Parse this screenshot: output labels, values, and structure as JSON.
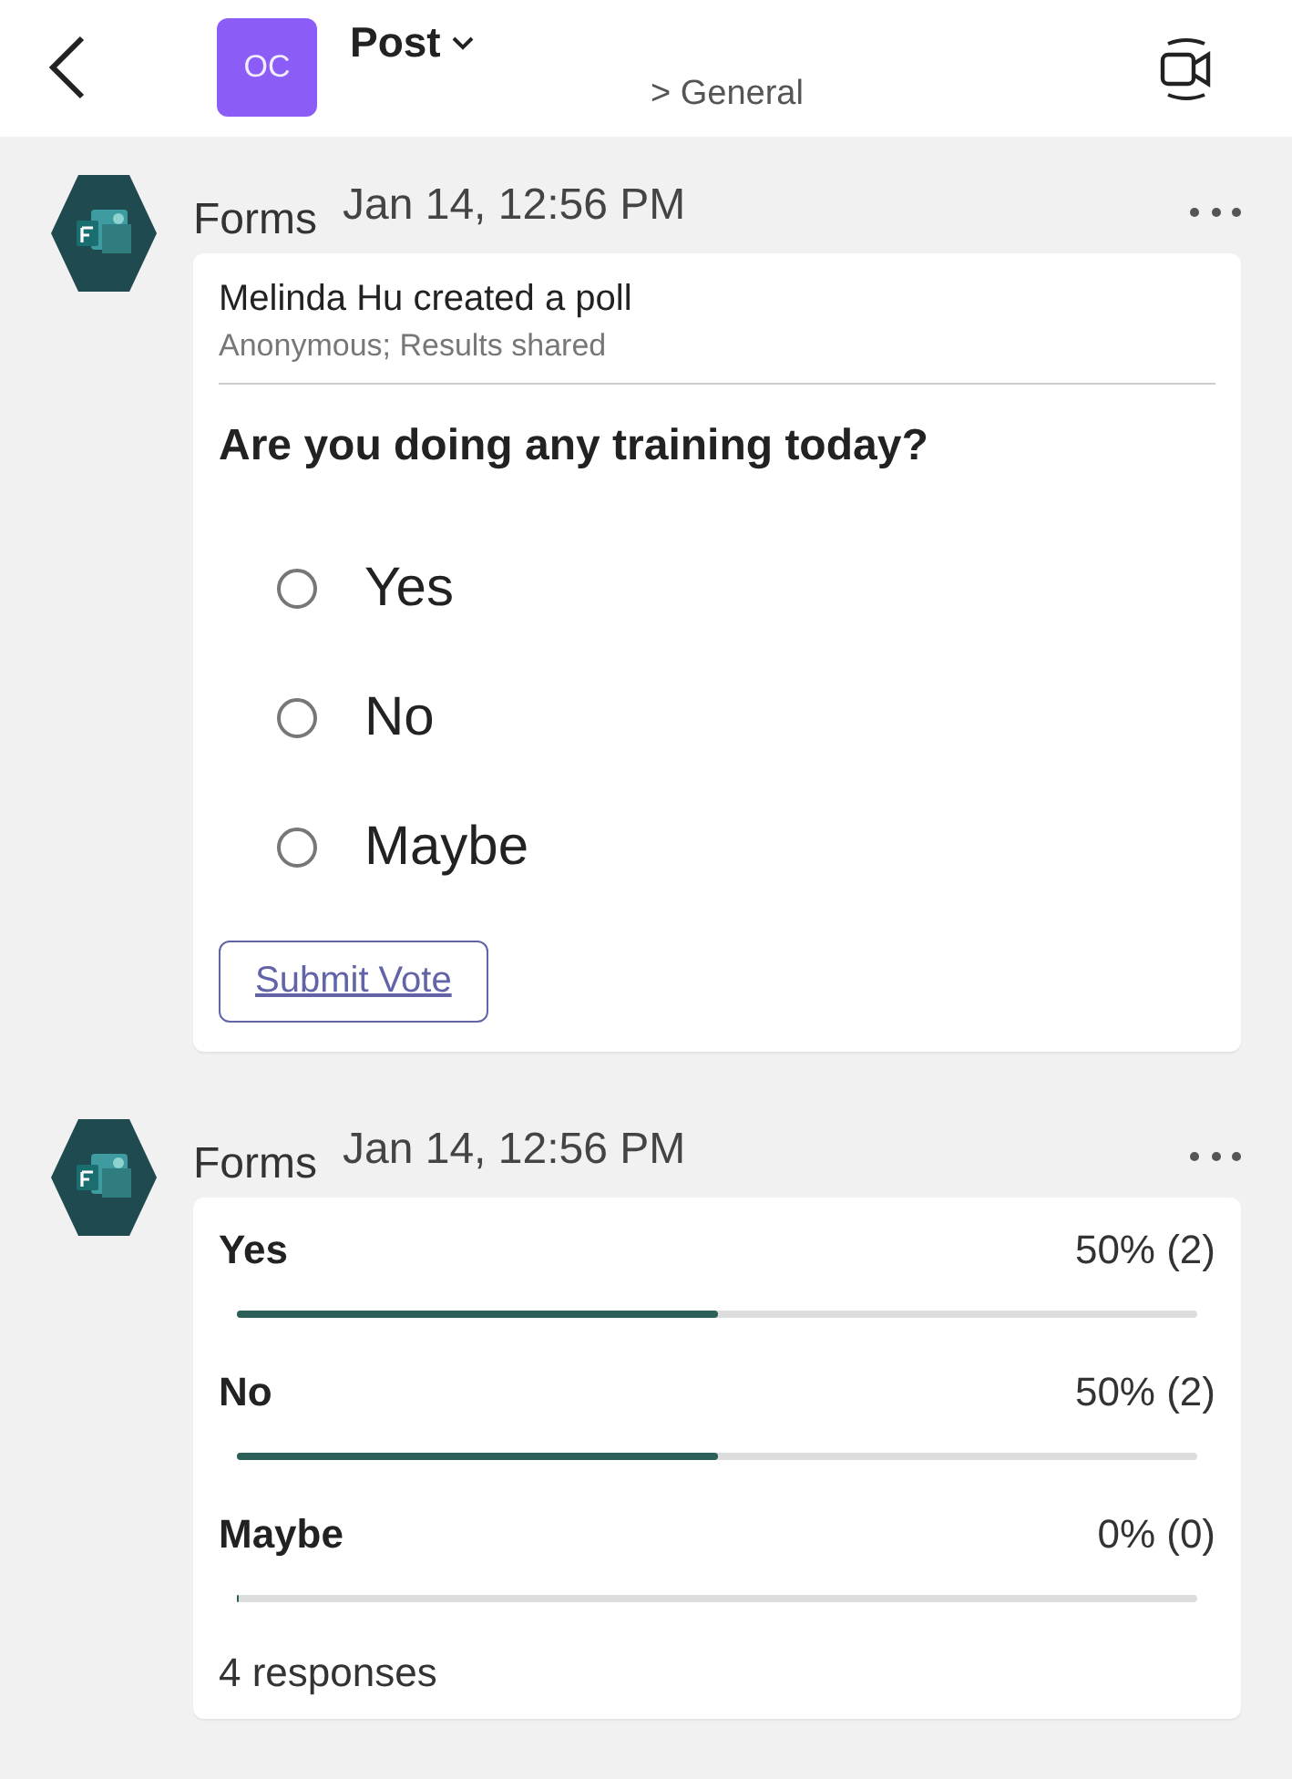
{
  "header": {
    "avatar": "OC",
    "title": "Post",
    "subtitle": "> General"
  },
  "messages": [
    {
      "kind": "poll",
      "sender": "Forms",
      "time": "Jan 14, 12:56 PM",
      "creator": "Melinda Hu created a poll",
      "meta": "Anonymous; Results shared",
      "question": "Are you doing any training today?",
      "options": [
        {
          "label": "Yes",
          "selected": false
        },
        {
          "label": "No",
          "selected": false
        },
        {
          "label": "Maybe",
          "selected": false
        }
      ],
      "button": "Submit Vote"
    },
    {
      "kind": "results",
      "sender": "Forms",
      "time": "Jan 14, 12:56 PM",
      "results": [
        {
          "label": "Yes",
          "reading": "50% (2)",
          "level": 0.5
        },
        {
          "label": "No",
          "reading": "50% (2)",
          "level": 0.5
        },
        {
          "label": "Maybe",
          "reading": "0% (0)",
          "level": 0
        }
      ],
      "footer": "4 responses"
    }
  ]
}
